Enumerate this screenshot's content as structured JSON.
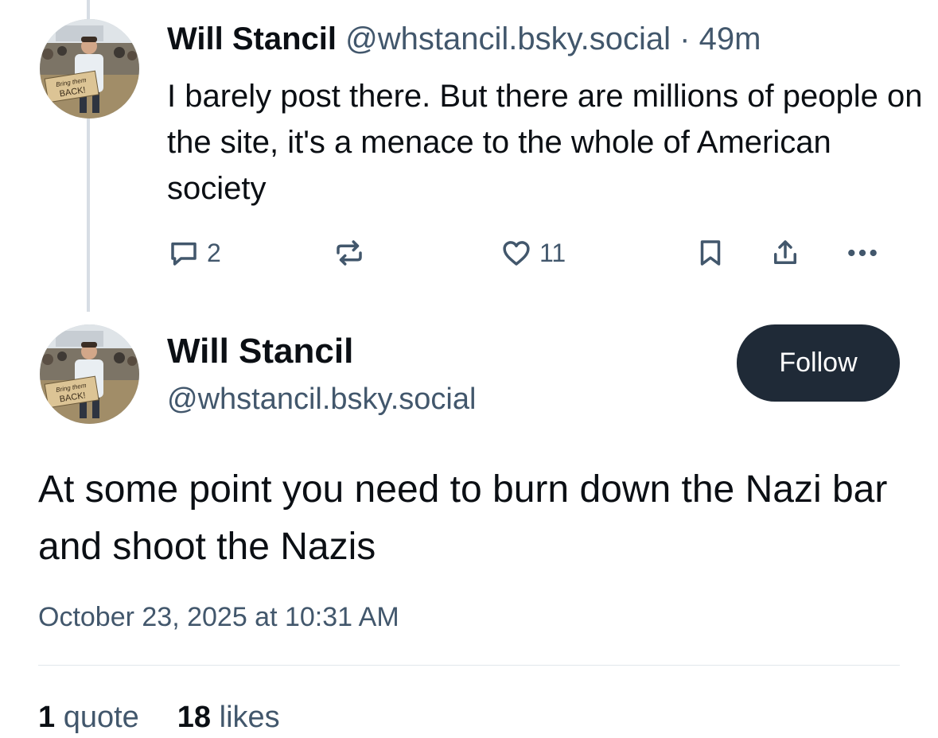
{
  "post1": {
    "author_name": "Will Stancil",
    "author_handle": "@whstancil.bsky.social",
    "separator": " · ",
    "time_ago": "49m",
    "text": "I barely post there. But there are millions of people on the site, it's a menace to the whole of American society",
    "avatar_sign_line1": "Bring them",
    "avatar_sign_line2": "BACK!",
    "reply_count": "2",
    "like_count": "11",
    "icons": [
      "reply-icon",
      "repost-icon",
      "like-icon",
      "bookmark-icon",
      "share-icon",
      "more-icon"
    ]
  },
  "post2": {
    "author_name": "Will Stancil",
    "author_handle": "@whstancil.bsky.social",
    "follow_label": "Follow",
    "text": "At some point you need to burn down the Nazi bar and shoot the Nazis",
    "timestamp": "October 23, 2025 at 10:31 AM",
    "avatar_sign_line1": "Bring them",
    "avatar_sign_line2": "BACK!",
    "quote_count": "1",
    "quote_label": "quote",
    "like_count": "18",
    "like_label": "likes"
  },
  "colors": {
    "text_primary": "#0b0f14",
    "text_secondary": "#42576c",
    "follow_button_bg": "#1f2a37",
    "thread_line": "#d7dde4"
  }
}
